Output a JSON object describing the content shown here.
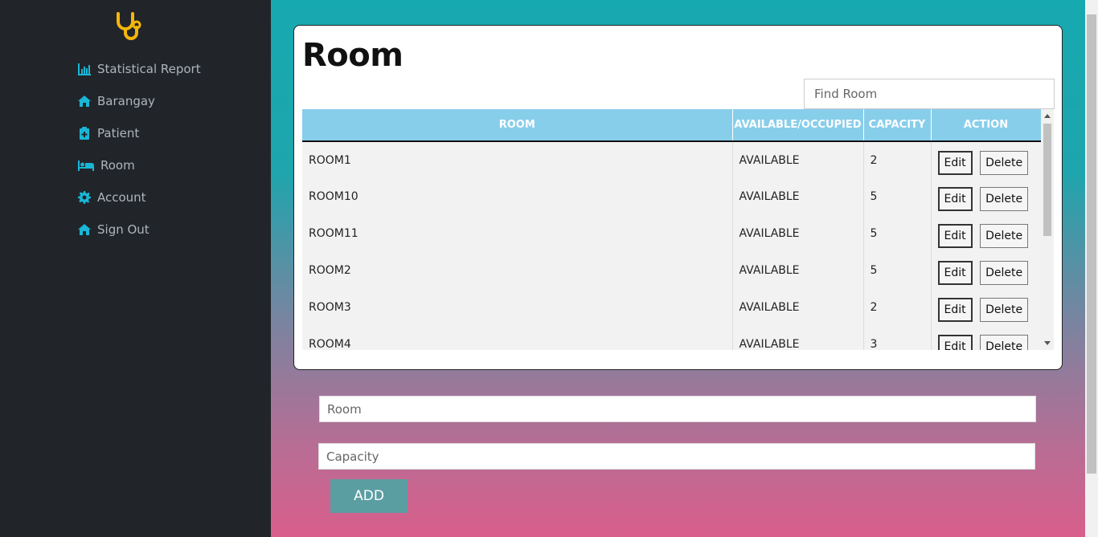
{
  "sidebar": {
    "logo_icon": "stethoscope-icon",
    "items": [
      {
        "label": "Statistical Report",
        "icon": "bar-chart-icon"
      },
      {
        "label": "Barangay",
        "icon": "home-icon"
      },
      {
        "label": "Patient",
        "icon": "clipboard-plus-icon"
      },
      {
        "label": "Room",
        "icon": "bed-icon"
      },
      {
        "label": "Account",
        "icon": "gear-icon"
      },
      {
        "label": "Sign Out",
        "icon": "home-icon"
      }
    ]
  },
  "card": {
    "title": "Room",
    "search_placeholder": "Find Room"
  },
  "table": {
    "headers": [
      "ROOM",
      "AVAILABLE/OCCUPIED",
      "CAPACITY",
      "ACTION"
    ],
    "edit_label": "Edit",
    "delete_label": "Delete",
    "rows": [
      {
        "room": "ROOM1",
        "status": "AVAILABLE",
        "capacity": "2"
      },
      {
        "room": "ROOM10",
        "status": "AVAILABLE",
        "capacity": "5"
      },
      {
        "room": "ROOM11",
        "status": "AVAILABLE",
        "capacity": "5"
      },
      {
        "room": "ROOM2",
        "status": "AVAILABLE",
        "capacity": "5"
      },
      {
        "room": "ROOM3",
        "status": "AVAILABLE",
        "capacity": "2"
      },
      {
        "room": "ROOM4",
        "status": "AVAILABLE",
        "capacity": "3"
      }
    ]
  },
  "form": {
    "room_placeholder": "Room",
    "capacity_placeholder": "Capacity",
    "add_label": "ADD"
  },
  "colors": {
    "sidebar_bg": "#212529",
    "accent_icon": "#1ab6d6",
    "logo": "#f5b50a",
    "table_header": "#87ceeb"
  }
}
